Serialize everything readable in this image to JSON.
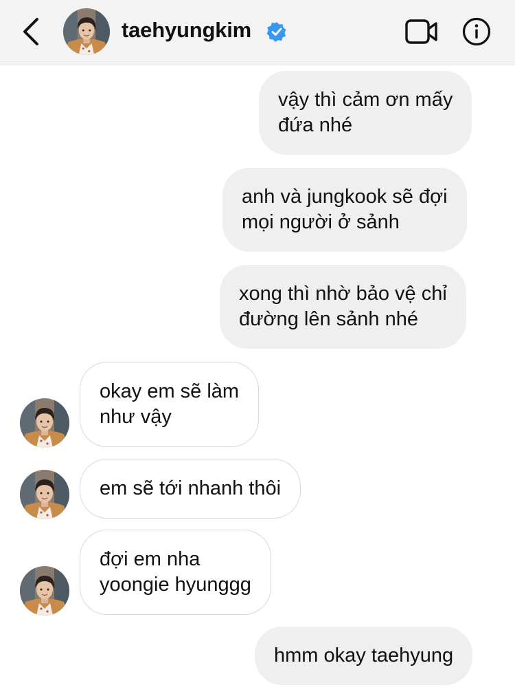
{
  "header": {
    "username": "taehyungkim",
    "verified": true,
    "icons": [
      "back-arrow-icon",
      "verified-badge-icon",
      "video-call-icon",
      "info-icon"
    ]
  },
  "colors": {
    "header_bg": "#f3f3f4",
    "outgoing_bubble": "#efefef",
    "incoming_bubble_border": "#d8d8d8",
    "verified_blue": "#3897f0"
  },
  "messages": [
    {
      "side": "outgoing",
      "lines": [
        "vậy thì cảm ơn mấy",
        "đứa nhé"
      ]
    },
    {
      "side": "outgoing",
      "lines": [
        "anh và jungkook sẽ đợi",
        "mọi người ở sảnh"
      ]
    },
    {
      "side": "outgoing",
      "lines": [
        "xong thì nhờ bảo vệ chỉ",
        "đường lên sảnh nhé"
      ]
    },
    {
      "side": "incoming",
      "lines": [
        "okay em sẽ làm",
        "như vậy"
      ]
    },
    {
      "side": "incoming",
      "lines": [
        "em sẽ tới nhanh thôi"
      ]
    },
    {
      "side": "incoming",
      "lines": [
        "đợi em nha",
        "yoongie hyunggg"
      ]
    },
    {
      "side": "outgoing",
      "lines": [
        "hmm okay taehyung"
      ]
    }
  ]
}
